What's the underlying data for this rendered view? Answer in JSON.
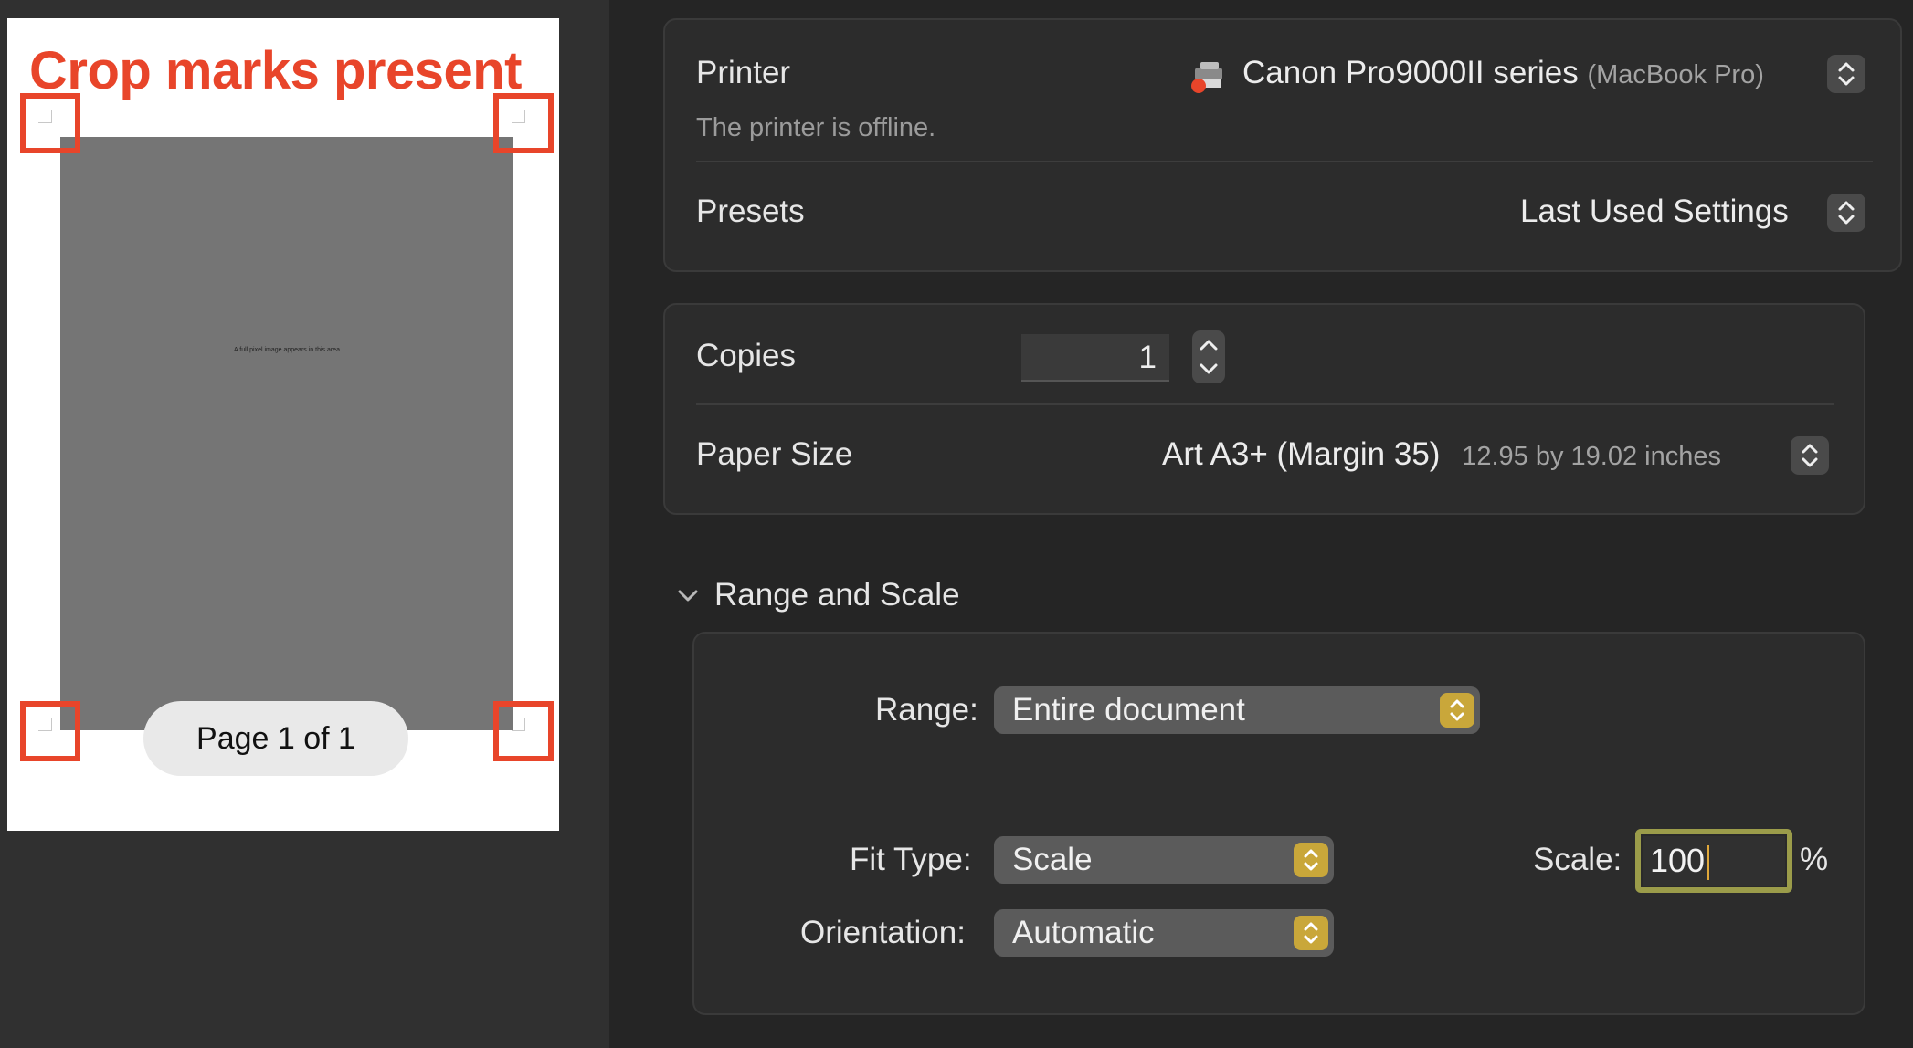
{
  "preview": {
    "annotation": "Crop marks present",
    "image_caption": "A full pixel image appears in this area",
    "page_indicator": "Page 1 of 1"
  },
  "printer": {
    "label": "Printer",
    "name": "Canon Pro9000II series",
    "host": "(MacBook Pro)",
    "status": "The printer is offline.",
    "icon": "printer-icon",
    "status_color": "#e8452a"
  },
  "presets": {
    "label": "Presets",
    "value": "Last Used Settings"
  },
  "copies": {
    "label": "Copies",
    "value": "1"
  },
  "paper_size": {
    "label": "Paper Size",
    "value": "Art A3+ (Margin 35)",
    "dimensions": "12.95 by 19.02 inches"
  },
  "range_and_scale": {
    "header": "Range and Scale",
    "range_label": "Range:",
    "range_value": "Entire document",
    "fit_type_label": "Fit Type:",
    "fit_type_value": "Scale",
    "orientation_label": "Orientation:",
    "orientation_value": "Automatic",
    "scale_label": "Scale:",
    "scale_value": "100",
    "scale_unit": "%"
  },
  "colors": {
    "accent_popup": "#c9a73a",
    "focus_ring": "#9b9c4a",
    "annotation_red": "#e8452a"
  }
}
